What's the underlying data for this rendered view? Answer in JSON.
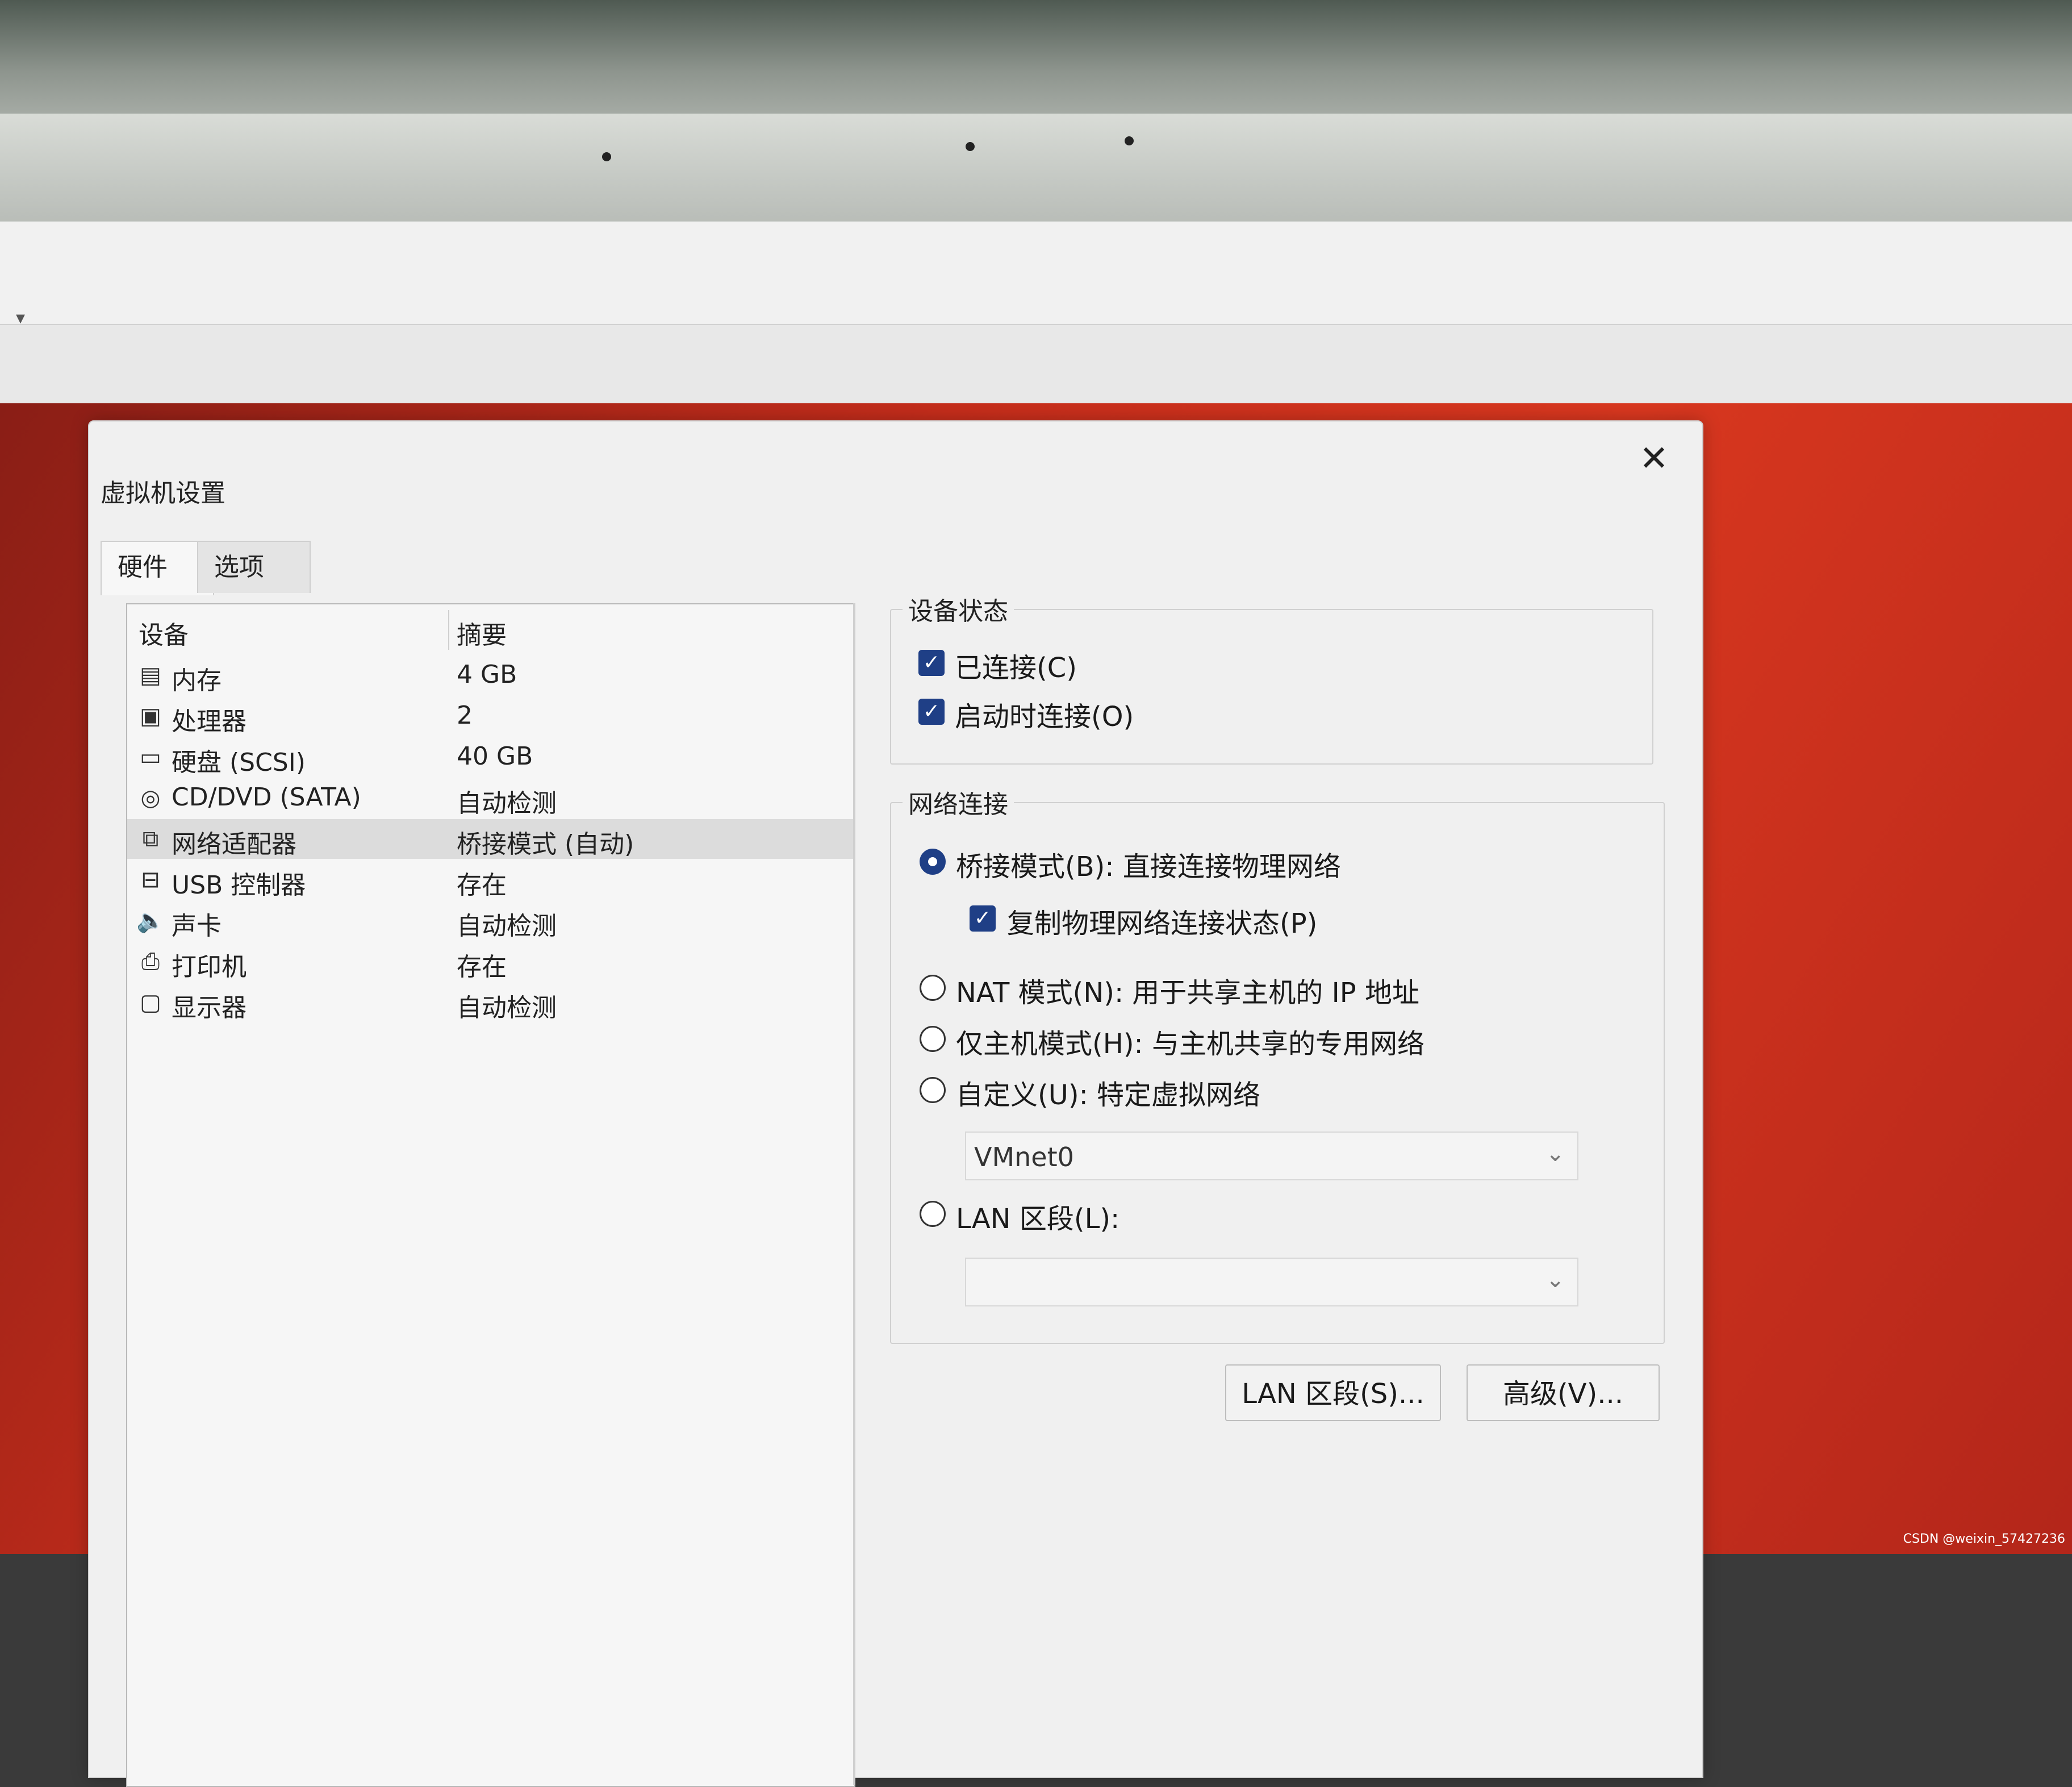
{
  "dialog": {
    "title": "虚拟机设置",
    "close_symbol": "✕",
    "tabs": [
      {
        "label": "硬件",
        "active": true
      },
      {
        "label": "选项",
        "active": false
      }
    ]
  },
  "device_list": {
    "columns": [
      "设备",
      "摘要"
    ],
    "rows": [
      {
        "icon": "memory-icon",
        "glyph": "▤",
        "name": "内存",
        "summary": "4 GB"
      },
      {
        "icon": "processor-icon",
        "glyph": "▣",
        "name": "处理器",
        "summary": "2"
      },
      {
        "icon": "hard-disk-icon",
        "glyph": "▭",
        "name": "硬盘 (SCSI)",
        "summary": "40 GB"
      },
      {
        "icon": "cd-dvd-icon",
        "glyph": "◎",
        "name": "CD/DVD (SATA)",
        "summary": "自动检测"
      },
      {
        "icon": "network-adapter-icon",
        "glyph": "⧉",
        "name": "网络适配器",
        "summary": "桥接模式 (自动)",
        "selected": true
      },
      {
        "icon": "usb-controller-icon",
        "glyph": "⊟",
        "name": "USB 控制器",
        "summary": "存在"
      },
      {
        "icon": "sound-card-icon",
        "glyph": "🔈",
        "name": "声卡",
        "summary": "自动检测"
      },
      {
        "icon": "printer-icon",
        "glyph": "⎙",
        "name": "打印机",
        "summary": "存在"
      },
      {
        "icon": "display-icon",
        "glyph": "▢",
        "name": "显示器",
        "summary": "自动检测"
      }
    ]
  },
  "device_status": {
    "title": "设备状态",
    "connected": {
      "label": "已连接(C)",
      "checked": true
    },
    "connect_at_power_on": {
      "label": "启动时连接(O)",
      "checked": true
    }
  },
  "network_connection": {
    "title": "网络连接",
    "bridged": {
      "label": "桥接模式(B): 直接连接物理网络",
      "selected": true
    },
    "replicate": {
      "label": "复制物理网络连接状态(P)",
      "checked": true
    },
    "nat": {
      "label": "NAT 模式(N): 用于共享主机的 IP 地址",
      "selected": false
    },
    "host_only": {
      "label": "仅主机模式(H): 与主机共享的专用网络",
      "selected": false
    },
    "custom": {
      "label": "自定义(U): 特定虚拟网络",
      "selected": false
    },
    "custom_value": "VMnet0",
    "lan_segment": {
      "label": "LAN 区段(L):",
      "selected": false
    },
    "lan_segment_value": ""
  },
  "buttons": {
    "lan_segments": "LAN 区段(S)...",
    "advanced": "高级(V)..."
  },
  "host": {
    "dropdown_arrow": "▾"
  },
  "watermark": "CSDN @weixin_57427236",
  "colors": {
    "accent": "#1f3f86",
    "desktop_red": "#d8371f"
  }
}
